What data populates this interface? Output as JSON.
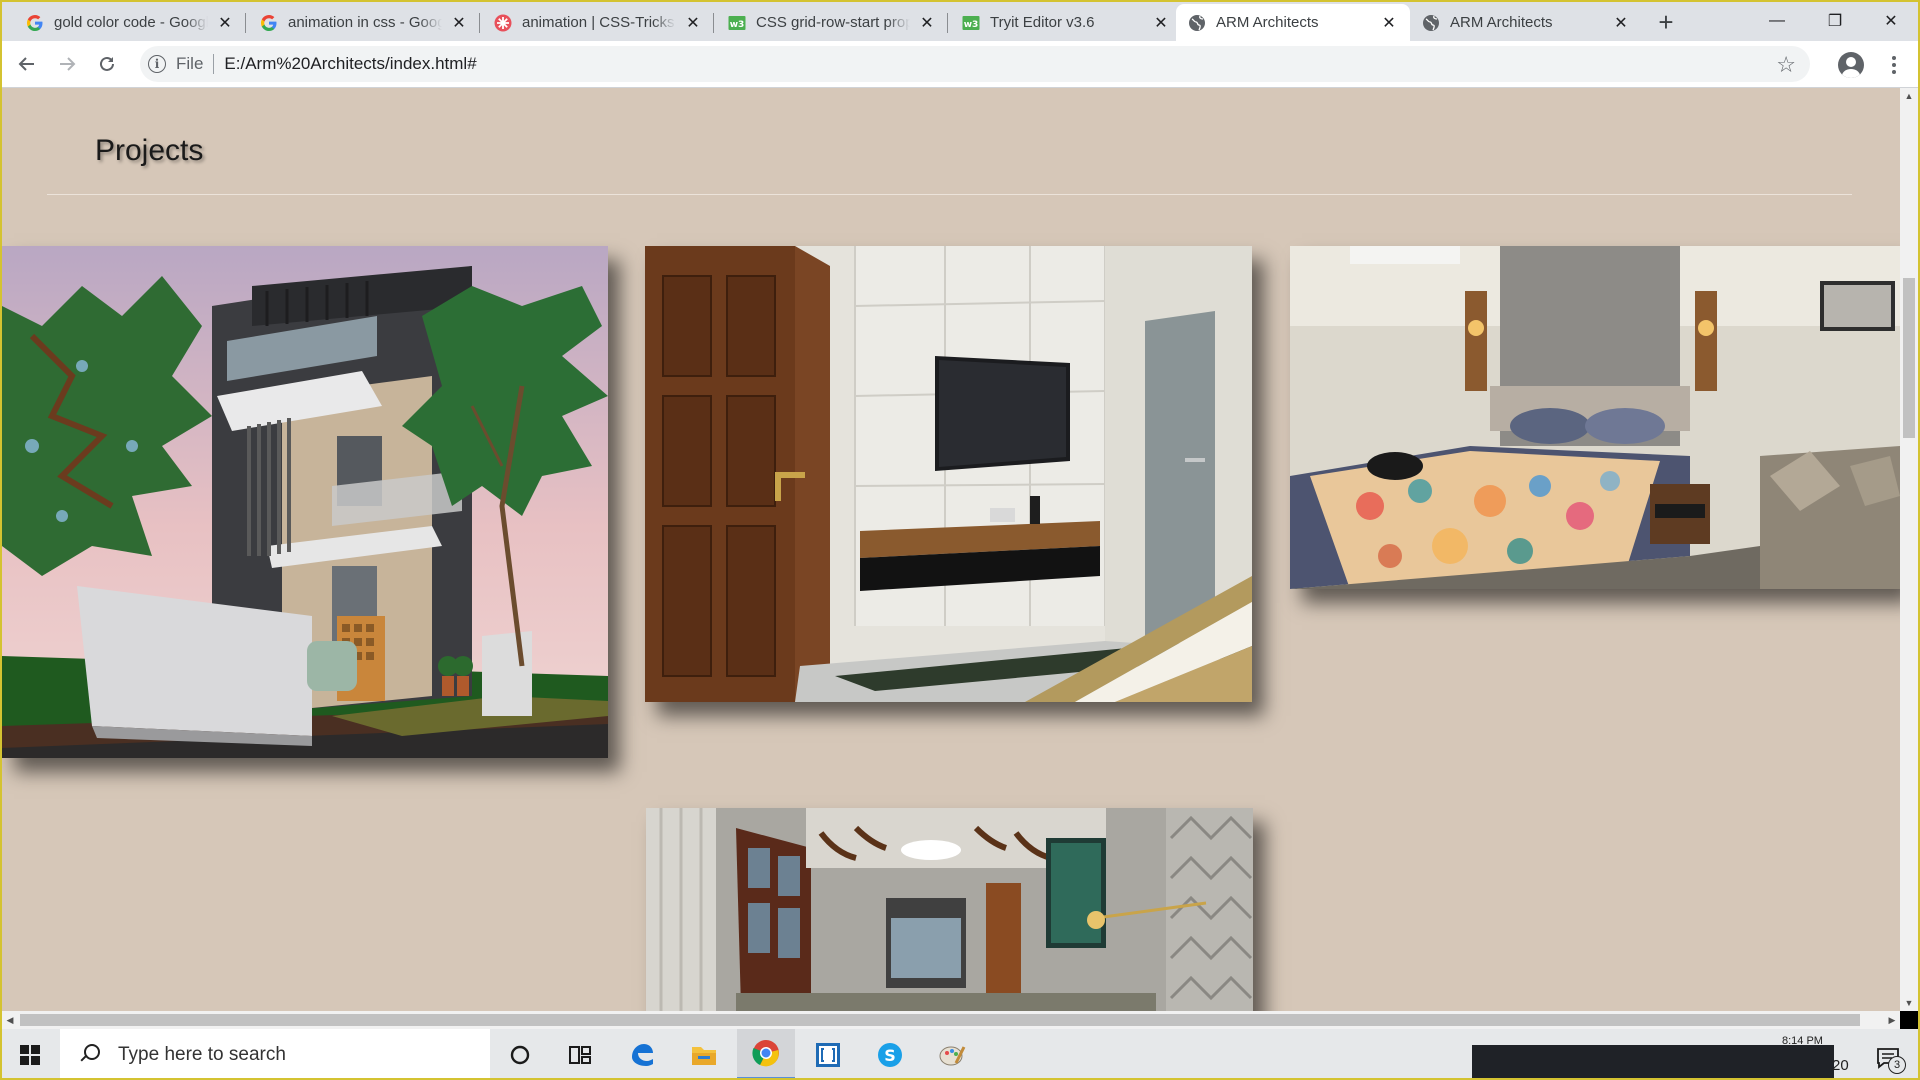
{
  "browser": {
    "tabs": [
      {
        "title": "gold color code - Google Search",
        "favicon": "google-icon"
      },
      {
        "title": "animation in css - Google Search",
        "favicon": "google-icon"
      },
      {
        "title": "animation | CSS-Tricks",
        "favicon": "css-tricks-icon"
      },
      {
        "title": "CSS grid-row-start property",
        "favicon": "w3schools-icon"
      },
      {
        "title": "Tryit Editor v3.6",
        "favicon": "w3schools-icon"
      },
      {
        "title": "ARM Architects",
        "favicon": "globe-icon",
        "active": true
      },
      {
        "title": "ARM Architects",
        "favicon": "globe-icon"
      }
    ],
    "new_tab": "+",
    "address": {
      "scheme_label": "File",
      "url": "E:/Arm%20Architects/index.html#"
    },
    "window_controls": {
      "minimize": "—",
      "maximize": "❐",
      "close": "✕"
    }
  },
  "page": {
    "heading": "Projects",
    "background_color": "#d6c7b8",
    "projects": [
      {
        "name": "project-card-house-exterior",
        "subject": "house exterior render"
      },
      {
        "name": "project-card-tv-room",
        "subject": "bedroom tv wall"
      },
      {
        "name": "project-card-bedroom",
        "subject": "bedroom interior"
      },
      {
        "name": "project-card-living-room",
        "subject": "living room render"
      }
    ]
  },
  "taskbar": {
    "search_placeholder": "Type here to search",
    "clock_time": "8:14 PM",
    "clock_date": "20",
    "notification_count": "3",
    "pinned": [
      "cortana-icon",
      "task-view-icon",
      "edge-icon",
      "file-explorer-icon",
      "chrome-icon",
      "brackets-icon",
      "skype-icon",
      "paint-icon"
    ]
  },
  "colors": {
    "accent": "#1a73e8",
    "page_bg": "#d6c7b8",
    "tab_bar": "#dee1e6"
  }
}
